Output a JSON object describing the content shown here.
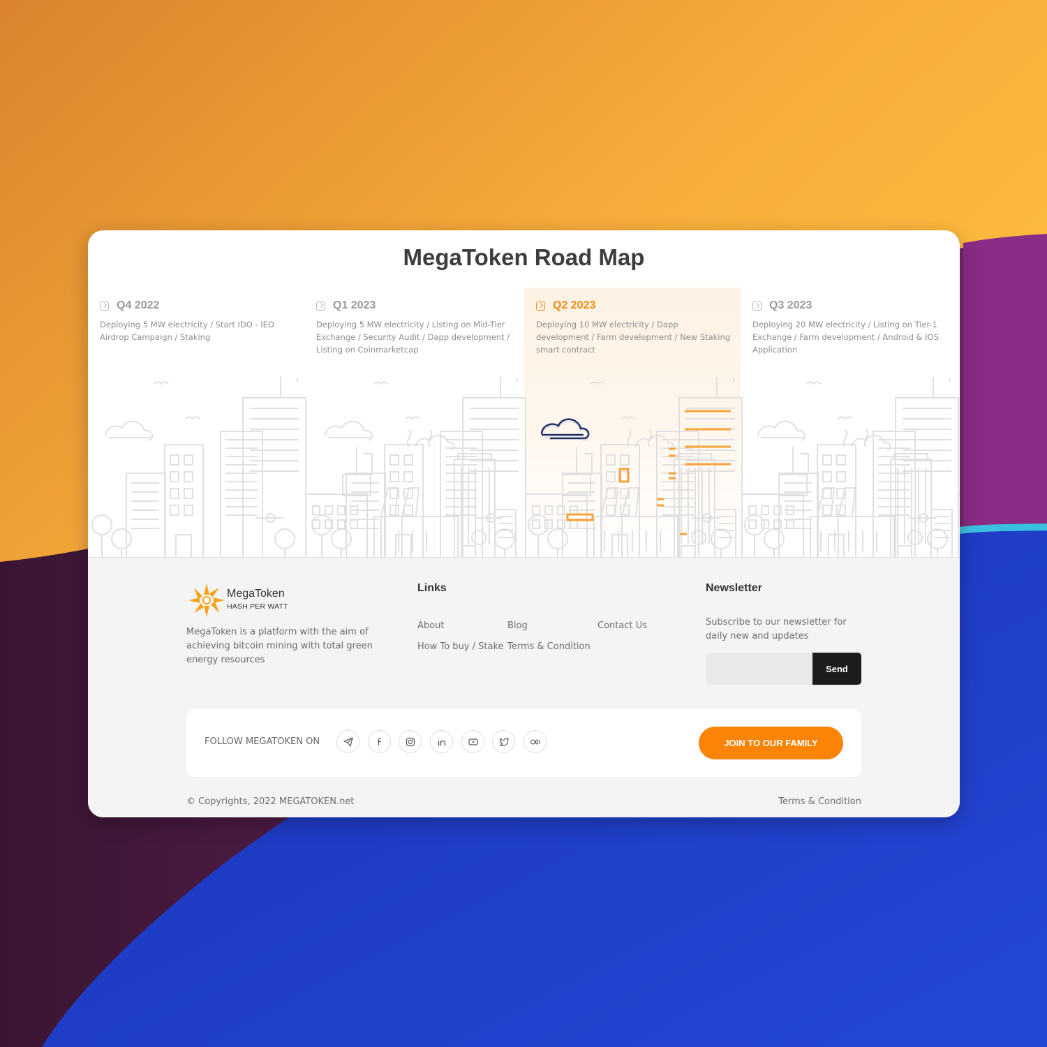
{
  "roadmap": {
    "title": "MegaToken Road Map",
    "milestones": [
      {
        "quarter": "Q4 2022",
        "description": "Deploying 5 MW electricity / Start IDO - IEO Airdrop Campaign / Staking"
      },
      {
        "quarter": "Q1 2023",
        "description": "Deploying 5 MW electricity / Listing on Mid-Tier Exchange / Security Audit / Dapp development / Listing on Coinmarketcap"
      },
      {
        "quarter": "Q2 2023",
        "description": "Deploying 10 MW electricity / Dapp development / Farm development / New Staking smart contract"
      },
      {
        "quarter": "Q3 2023",
        "description": "Deploying 20 MW electricity / Listing on Tier-1 Exchange / Farm development / Android & IOS Application"
      }
    ]
  },
  "footer": {
    "brand": {
      "name": "MegaToken",
      "tagline": "HASH PER WATT"
    },
    "about": "MegaToken is a platform with the aim of achieving bitcoin mining with total green energy resources",
    "links": {
      "title": "Links",
      "items": [
        "About",
        "Blog",
        "Contact Us",
        "How To buy / Stake",
        "Terms & Condition"
      ]
    },
    "newsletter": {
      "title": "Newsletter",
      "text": "Subscribe to our newsletter for daily new and updates",
      "placeholder": "",
      "button": "Send"
    },
    "follow": {
      "label": "FOLLOW MEGATOKEN ON",
      "icons": [
        "telegram-icon",
        "facebook-icon",
        "instagram-icon",
        "linkedin-icon",
        "youtube-icon",
        "twitter-icon",
        "medium-icon"
      ]
    },
    "join_button": "JOIN TO OUR FAMILY",
    "copyright": "© Copyrights, 2022 MEGATOKEN.net",
    "terms": "Terms & Condition"
  },
  "colors": {
    "accent": "#fb8406",
    "highlight": "#f18a16",
    "dark_button": "#1c1c1c"
  }
}
